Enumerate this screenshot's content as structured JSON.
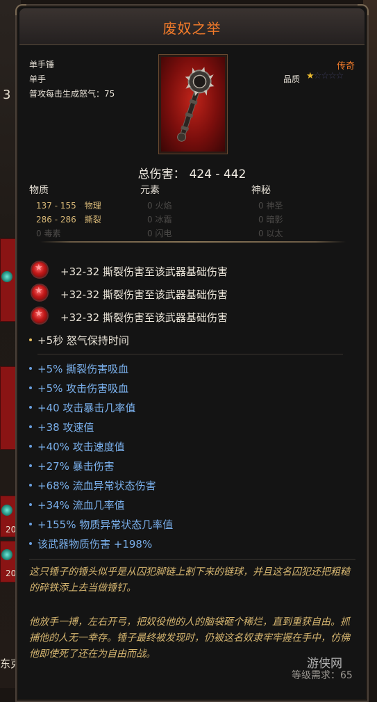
{
  "item": {
    "name": "废奴之举",
    "type": "单手锤",
    "hand": "单手",
    "rage_line": "普攻每击生成怒气：75",
    "rarity": "传奇",
    "quality_label": "品质",
    "quality_stars": 1,
    "quality_max": 5
  },
  "damage": {
    "total_label": "总伤害：",
    "total_value": "424 - 442",
    "columns": [
      "物质",
      "元素",
      "神秘"
    ],
    "rows": [
      [
        {
          "value": "137 - 155",
          "label": "物理",
          "active": true
        },
        {
          "value": "0",
          "label": "火焰",
          "active": false
        },
        {
          "value": "0",
          "label": "神圣",
          "active": false
        }
      ],
      [
        {
          "value": "286 - 286",
          "label": "撕裂",
          "active": true
        },
        {
          "value": "0",
          "label": "冰霜",
          "active": false
        },
        {
          "value": "0",
          "label": "暗影",
          "active": false
        }
      ],
      [
        {
          "value": "0",
          "label": "毒素",
          "active": false
        },
        {
          "value": "0",
          "label": "闪电",
          "active": false
        },
        {
          "value": "0",
          "label": "以太",
          "active": false
        }
      ]
    ]
  },
  "sockets": [
    "+32-32 撕裂伤害至该武器基础伤害",
    "+32-32 撕裂伤害至该武器基础伤害",
    "+32-32 撕裂伤害至该武器基础伤害"
  ],
  "implicit": "+5秒 怒气保持时间",
  "affixes": [
    "+5% 撕裂伤害吸血",
    "+5% 攻击伤害吸血",
    "+40 攻击暴击几率值",
    "+38 攻速值",
    "+40% 攻击速度值",
    "+27% 暴击伤害",
    "+68% 流血异常状态伤害",
    "+34% 流血几率值",
    "+155% 物质异常状态几率值",
    "该武器物质伤害 +198%"
  ],
  "lore": [
    "这只锤子的锤头似乎是从囚犯脚链上割下来的链球，并且这名囚犯还把粗糙的碎铁添上去当做锤钉。",
    "他放手一搏，左右开弓，把奴役他的人的脑袋砸个稀烂，直到重获自由。抓捕他的人无一幸存。锤子最终被发现时，仍被这名奴隶牢牢握在手中，仿佛他即使死了还在为自由而战。"
  ],
  "level_req": "等级需求：65",
  "watermark": "游侠网",
  "background": {
    "left_number": "3",
    "left_level_1": "20",
    "left_level_2": "20",
    "left_text": "东克"
  },
  "colors": {
    "title": "#f07a2a",
    "affix": "#7ab0ec",
    "lore": "#d6b670",
    "physical": "#d8b877"
  }
}
